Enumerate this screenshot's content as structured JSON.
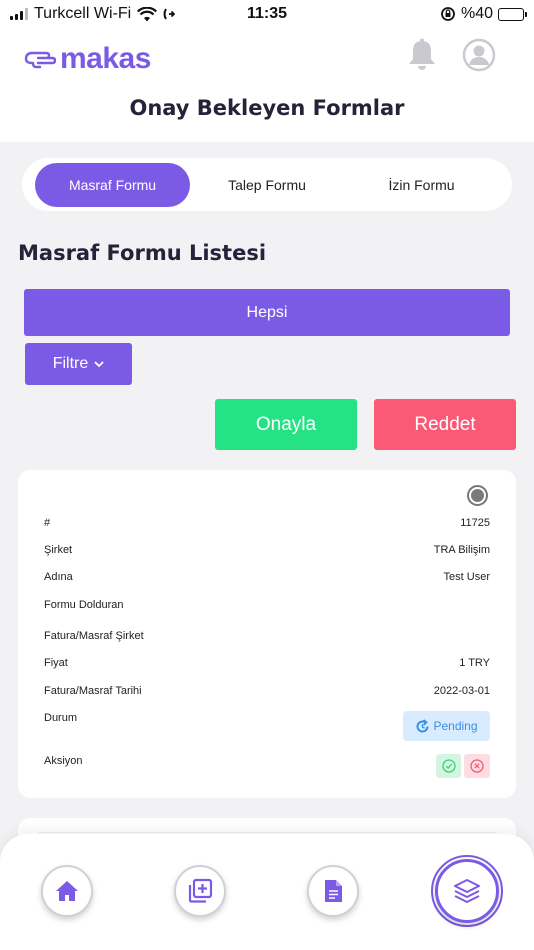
{
  "status_bar": {
    "carrier": "Turkcell Wi-Fi",
    "time": "11:35",
    "battery": "%40",
    "battery_level": 0.4
  },
  "header": {
    "logo_text": "makas",
    "title": "Onay Bekleyen Formlar",
    "icons": [
      "bell-icon",
      "user-avatar-icon"
    ]
  },
  "tabs": [
    {
      "label": "Masraf Formu",
      "active": true
    },
    {
      "label": "Talep Formu",
      "active": false
    },
    {
      "label": "İzin Formu",
      "active": false
    }
  ],
  "list": {
    "title": "Masraf Formu Listesi",
    "all_button": "Hepsi",
    "filter_button": "Filtre",
    "approve_button": "Onayla",
    "reject_button": "Reddet"
  },
  "record": {
    "selected": true,
    "fields": {
      "id": {
        "label": "#",
        "value": "11725"
      },
      "company": {
        "label": "Şirket",
        "value": "TRA Bilişim"
      },
      "name": {
        "label": "Adına",
        "value": "Test User"
      },
      "filled_by": {
        "label": "Formu Dolduran",
        "value": ""
      },
      "invoice_company": {
        "label": "Fatura/Masraf Şirket",
        "value": ""
      },
      "price": {
        "label": "Fiyat",
        "value": "1 TRY"
      },
      "invoice_date": {
        "label": "Fatura/Masraf Tarihi",
        "value": "2022-03-01"
      },
      "status": {
        "label": "Durum",
        "value": "Pending"
      },
      "action": {
        "label": "Aksiyon"
      }
    }
  },
  "bottom_nav": [
    {
      "icon": "home-icon",
      "active": false
    },
    {
      "icon": "add-form-icon",
      "active": false
    },
    {
      "icon": "document-icon",
      "active": false
    },
    {
      "icon": "layers-icon",
      "active": true
    }
  ],
  "colors": {
    "primary": "#7b5be6",
    "approve": "#25e384",
    "reject": "#fb5a76",
    "background": "#f2f2f5",
    "pending_bg": "#d9ebff",
    "pending_text": "#3a8ee6"
  }
}
